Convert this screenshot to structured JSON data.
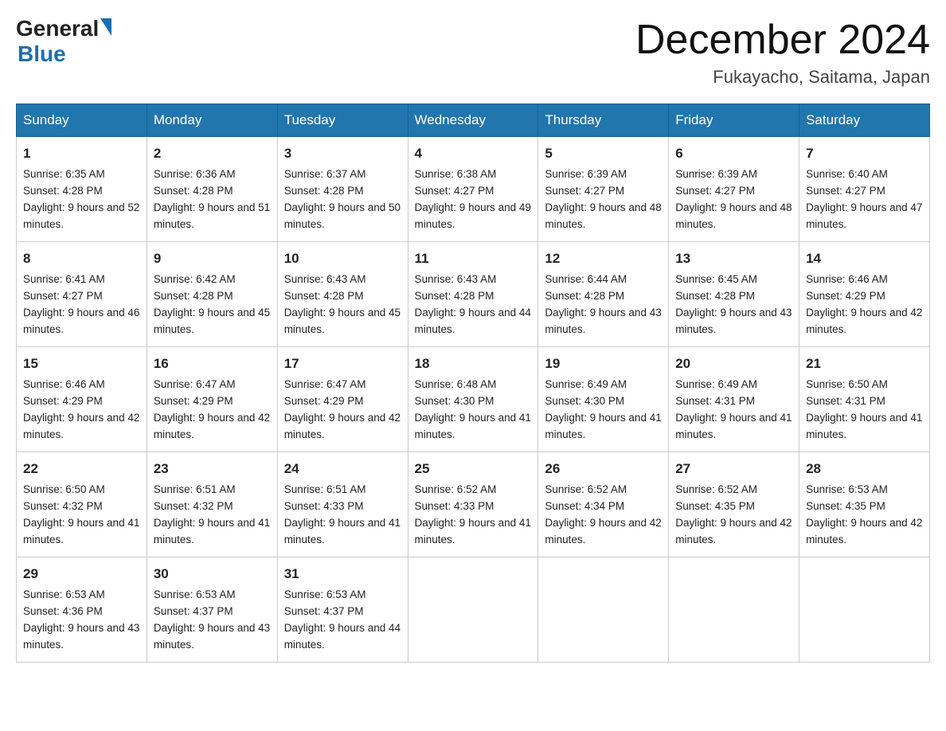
{
  "logo": {
    "general": "General",
    "blue": "Blue"
  },
  "title": "December 2024",
  "location": "Fukayacho, Saitama, Japan",
  "days_header": [
    "Sunday",
    "Monday",
    "Tuesday",
    "Wednesday",
    "Thursday",
    "Friday",
    "Saturday"
  ],
  "weeks": [
    [
      {
        "num": "1",
        "sunrise": "6:35 AM",
        "sunset": "4:28 PM",
        "daylight": "9 hours and 52 minutes."
      },
      {
        "num": "2",
        "sunrise": "6:36 AM",
        "sunset": "4:28 PM",
        "daylight": "9 hours and 51 minutes."
      },
      {
        "num": "3",
        "sunrise": "6:37 AM",
        "sunset": "4:28 PM",
        "daylight": "9 hours and 50 minutes."
      },
      {
        "num": "4",
        "sunrise": "6:38 AM",
        "sunset": "4:27 PM",
        "daylight": "9 hours and 49 minutes."
      },
      {
        "num": "5",
        "sunrise": "6:39 AM",
        "sunset": "4:27 PM",
        "daylight": "9 hours and 48 minutes."
      },
      {
        "num": "6",
        "sunrise": "6:39 AM",
        "sunset": "4:27 PM",
        "daylight": "9 hours and 48 minutes."
      },
      {
        "num": "7",
        "sunrise": "6:40 AM",
        "sunset": "4:27 PM",
        "daylight": "9 hours and 47 minutes."
      }
    ],
    [
      {
        "num": "8",
        "sunrise": "6:41 AM",
        "sunset": "4:27 PM",
        "daylight": "9 hours and 46 minutes."
      },
      {
        "num": "9",
        "sunrise": "6:42 AM",
        "sunset": "4:28 PM",
        "daylight": "9 hours and 45 minutes."
      },
      {
        "num": "10",
        "sunrise": "6:43 AM",
        "sunset": "4:28 PM",
        "daylight": "9 hours and 45 minutes."
      },
      {
        "num": "11",
        "sunrise": "6:43 AM",
        "sunset": "4:28 PM",
        "daylight": "9 hours and 44 minutes."
      },
      {
        "num": "12",
        "sunrise": "6:44 AM",
        "sunset": "4:28 PM",
        "daylight": "9 hours and 43 minutes."
      },
      {
        "num": "13",
        "sunrise": "6:45 AM",
        "sunset": "4:28 PM",
        "daylight": "9 hours and 43 minutes."
      },
      {
        "num": "14",
        "sunrise": "6:46 AM",
        "sunset": "4:29 PM",
        "daylight": "9 hours and 42 minutes."
      }
    ],
    [
      {
        "num": "15",
        "sunrise": "6:46 AM",
        "sunset": "4:29 PM",
        "daylight": "9 hours and 42 minutes."
      },
      {
        "num": "16",
        "sunrise": "6:47 AM",
        "sunset": "4:29 PM",
        "daylight": "9 hours and 42 minutes."
      },
      {
        "num": "17",
        "sunrise": "6:47 AM",
        "sunset": "4:29 PM",
        "daylight": "9 hours and 42 minutes."
      },
      {
        "num": "18",
        "sunrise": "6:48 AM",
        "sunset": "4:30 PM",
        "daylight": "9 hours and 41 minutes."
      },
      {
        "num": "19",
        "sunrise": "6:49 AM",
        "sunset": "4:30 PM",
        "daylight": "9 hours and 41 minutes."
      },
      {
        "num": "20",
        "sunrise": "6:49 AM",
        "sunset": "4:31 PM",
        "daylight": "9 hours and 41 minutes."
      },
      {
        "num": "21",
        "sunrise": "6:50 AM",
        "sunset": "4:31 PM",
        "daylight": "9 hours and 41 minutes."
      }
    ],
    [
      {
        "num": "22",
        "sunrise": "6:50 AM",
        "sunset": "4:32 PM",
        "daylight": "9 hours and 41 minutes."
      },
      {
        "num": "23",
        "sunrise": "6:51 AM",
        "sunset": "4:32 PM",
        "daylight": "9 hours and 41 minutes."
      },
      {
        "num": "24",
        "sunrise": "6:51 AM",
        "sunset": "4:33 PM",
        "daylight": "9 hours and 41 minutes."
      },
      {
        "num": "25",
        "sunrise": "6:52 AM",
        "sunset": "4:33 PM",
        "daylight": "9 hours and 41 minutes."
      },
      {
        "num": "26",
        "sunrise": "6:52 AM",
        "sunset": "4:34 PM",
        "daylight": "9 hours and 42 minutes."
      },
      {
        "num": "27",
        "sunrise": "6:52 AM",
        "sunset": "4:35 PM",
        "daylight": "9 hours and 42 minutes."
      },
      {
        "num": "28",
        "sunrise": "6:53 AM",
        "sunset": "4:35 PM",
        "daylight": "9 hours and 42 minutes."
      }
    ],
    [
      {
        "num": "29",
        "sunrise": "6:53 AM",
        "sunset": "4:36 PM",
        "daylight": "9 hours and 43 minutes."
      },
      {
        "num": "30",
        "sunrise": "6:53 AM",
        "sunset": "4:37 PM",
        "daylight": "9 hours and 43 minutes."
      },
      {
        "num": "31",
        "sunrise": "6:53 AM",
        "sunset": "4:37 PM",
        "daylight": "9 hours and 44 minutes."
      },
      null,
      null,
      null,
      null
    ]
  ]
}
